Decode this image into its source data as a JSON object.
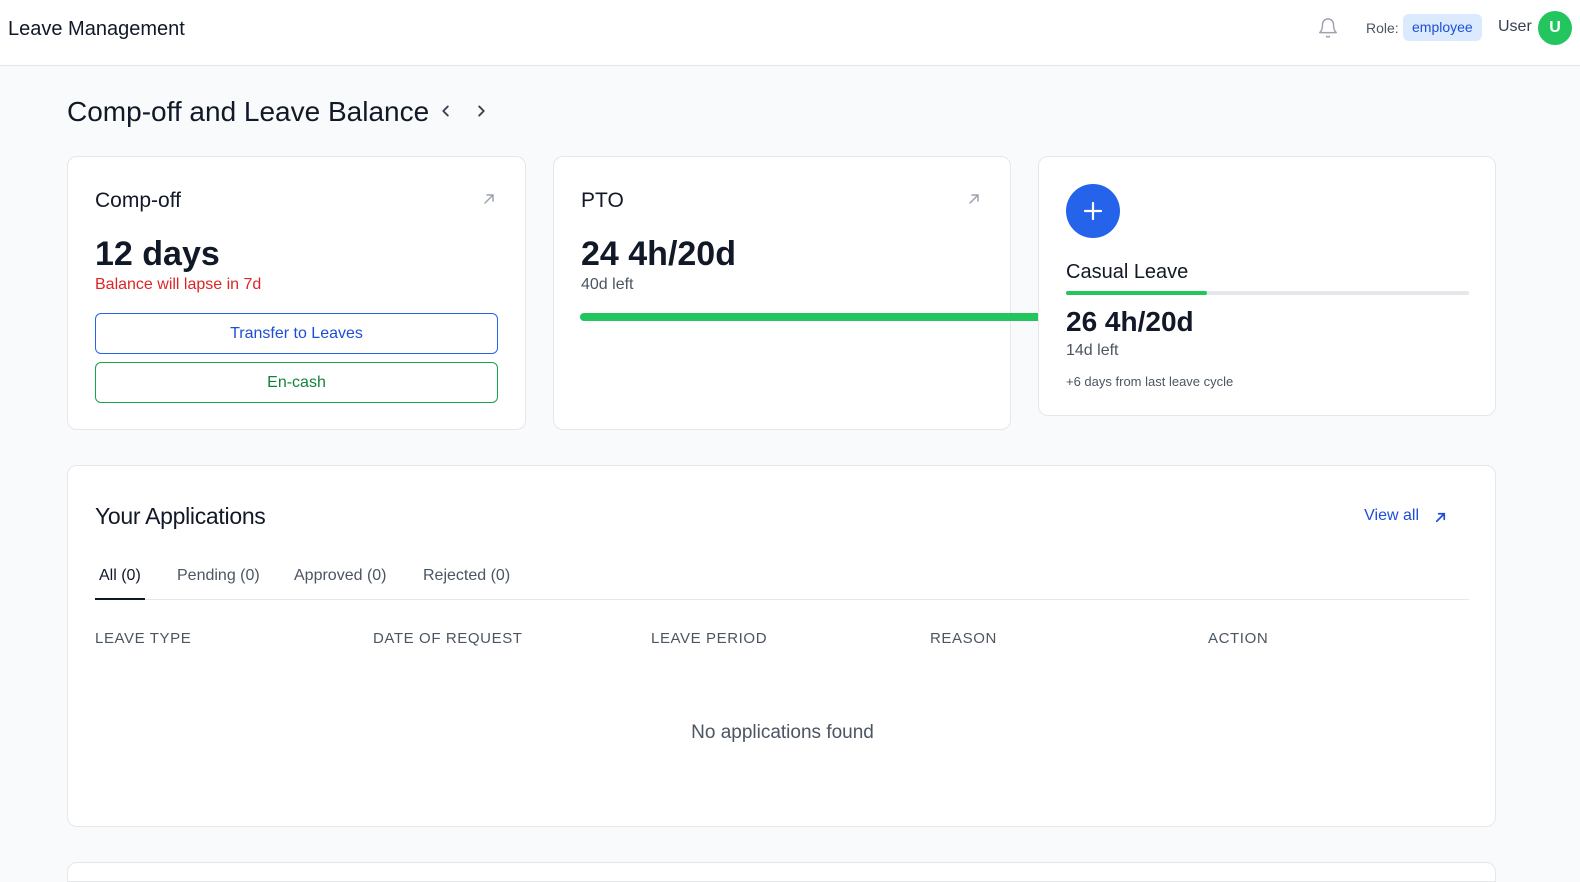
{
  "header": {
    "title": "Leave Management",
    "bell_icon": "bell-icon",
    "role_label": "Role:",
    "role_value": "employee",
    "user_label": "User",
    "avatar_initial": "U"
  },
  "balance": {
    "title": "Comp-off and Leave Balance",
    "prev_icon": "chevron-left-icon",
    "next_icon": "chevron-right-icon",
    "compoff": {
      "title": "Comp-off",
      "value": "12 days",
      "lapse_note": "Balance will lapse in 7d",
      "transfer_label": "Transfer to Leaves",
      "encash_label": "En-cash"
    },
    "pto": {
      "title": "PTO",
      "value": "24 4h/20d",
      "left_note": "40d left",
      "progress": 1.0
    },
    "casual": {
      "title": "Casual Leave",
      "value": "26 4h/20d",
      "left_note": "14d left",
      "extra_note": "+6 days from last leave cycle",
      "progress": 0.35
    }
  },
  "applications": {
    "title": "Your Applications",
    "view_all": "View all",
    "tabs": [
      {
        "label": "All (0)",
        "active": true
      },
      {
        "label": "Pending (0)",
        "active": false
      },
      {
        "label": "Approved (0)",
        "active": false
      },
      {
        "label": "Rejected (0)",
        "active": false
      }
    ],
    "columns": [
      "Leave Type",
      "Date of Request",
      "Leave Period",
      "Reason",
      "Action"
    ],
    "empty_message": "No applications found"
  },
  "colors": {
    "accent": "#2563eb",
    "success": "#22c55e",
    "danger": "#dc2626",
    "badge_bg": "#dbeafe"
  }
}
